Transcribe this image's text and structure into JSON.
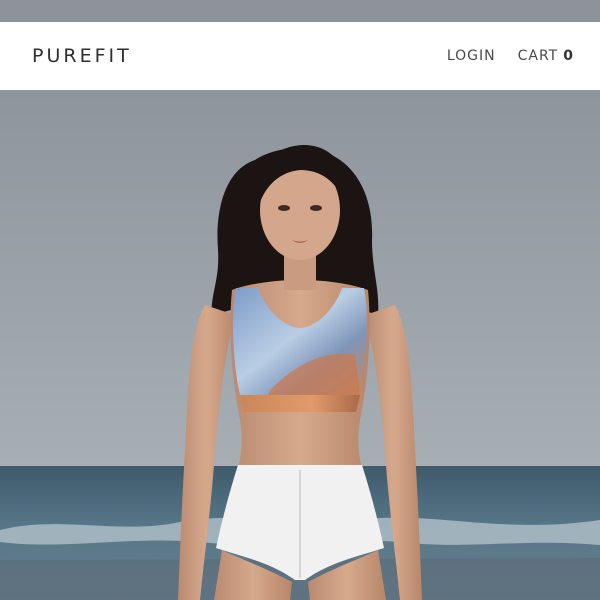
{
  "header": {
    "brand": "PUREFIT",
    "nav": {
      "login_label": "LOGIN",
      "cart_label": "CART",
      "cart_count": "0"
    }
  },
  "hero": {
    "image": "photo-model-beach-sports-bra"
  },
  "colors": {
    "header_bg": "#ffffff",
    "text_dark": "#2f2f2f",
    "sky": "#949ba2",
    "sea": "#4f6a7a"
  }
}
